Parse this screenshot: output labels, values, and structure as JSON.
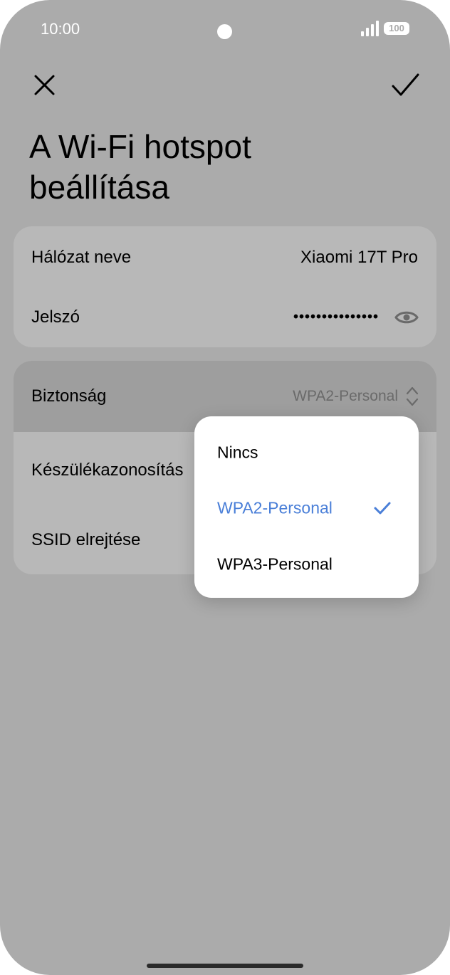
{
  "status_bar": {
    "time": "10:00",
    "battery": "100",
    "icons": [
      "camera-cutout",
      "signal-icon",
      "battery-icon"
    ]
  },
  "header": {
    "close_icon": "close-icon",
    "confirm_icon": "checkmark-icon",
    "title": "A Wi-Fi hotspot beállítása"
  },
  "card1": {
    "network_name_label": "Hálózat neve",
    "network_name_value": "Xiaomi 17T Pro",
    "password_label": "Jelszó",
    "password_value": "•••••••••••••••",
    "password_toggle_icon": "eye-icon"
  },
  "card2": {
    "security_label": "Biztonság",
    "security_value": "WPA2-Personal",
    "security_icon": "updown-chevron-icon",
    "device_id_label": "Készülékazonosítás",
    "hide_ssid_label": "SSID elrejtése"
  },
  "dropdown": {
    "options": [
      {
        "label": "Nincs",
        "selected": false
      },
      {
        "label": "WPA2-Personal",
        "selected": true
      },
      {
        "label": "WPA3-Personal",
        "selected": false
      }
    ],
    "selected_icon": "check-icon"
  },
  "colors": {
    "background_dim": "#ababab",
    "card": "#b8b8b8",
    "highlight_row": "#9e9e9e",
    "accent": "#4a7fd8"
  }
}
